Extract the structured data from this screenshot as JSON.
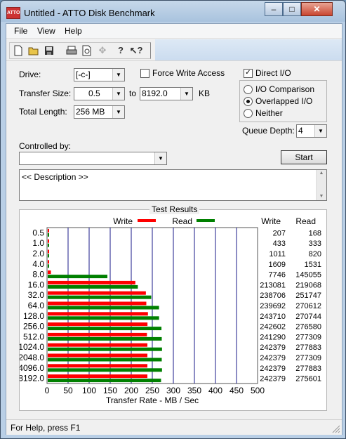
{
  "window": {
    "title": "Untitled - ATTO Disk Benchmark",
    "icon_text": "ATTO"
  },
  "caption_buttons": {
    "minimize": "–",
    "maximize": "□",
    "close": "✕"
  },
  "menu": {
    "file": "File",
    "view": "View",
    "help": "Help"
  },
  "toolbar": {
    "icons": [
      "new-icon",
      "open-icon",
      "save-icon",
      "print-icon",
      "print-preview-icon",
      "move-icon",
      "help-icon",
      "context-help-icon"
    ]
  },
  "form": {
    "drive_label": "Drive:",
    "drive_value": "[-c-]",
    "force_write_access_label": "Force Write Access",
    "force_write_access_checked": false,
    "direct_io_label": "Direct I/O",
    "direct_io_checked": true,
    "transfer_size_label": "Transfer Size:",
    "transfer_min": "0.5",
    "to_label": "to",
    "transfer_max": "8192.0",
    "transfer_unit": "KB",
    "total_length_label": "Total Length:",
    "total_length_value": "256 MB",
    "io_comparison_label": "I/O Comparison",
    "overlapped_io_label": "Overlapped I/O",
    "neither_label": "Neither",
    "selected_mode": "Overlapped I/O",
    "queue_depth_label": "Queue Depth:",
    "queue_depth_value": "4",
    "controlled_by_label": "Controlled by:",
    "controlled_by_value": "",
    "start_button": "Start",
    "description": "<< Description >>"
  },
  "results": {
    "title": "Test Results",
    "write_column": "Write",
    "read_column": "Read"
  },
  "chart_data": {
    "type": "bar",
    "xlabel": "Transfer Rate - MB / Sec",
    "xlim": [
      0,
      500
    ],
    "x_ticks": [
      "0",
      "50",
      "100",
      "150",
      "200",
      "250",
      "300",
      "350",
      "400",
      "450",
      "500"
    ],
    "grid": true,
    "legend": "top",
    "categories": [
      "0.5",
      "1.0",
      "2.0",
      "4.0",
      "8.0",
      "16.0",
      "32.0",
      "64.0",
      "128.0",
      "256.0",
      "512.0",
      "1024.0",
      "2048.0",
      "4096.0",
      "8192.0"
    ],
    "series": [
      {
        "name": "Write",
        "color": "#ff0000",
        "values": [
          0.2,
          0.42,
          0.99,
          1.57,
          7.6,
          208.1,
          233.1,
          234.1,
          238.0,
          236.9,
          235.6,
          236.7,
          236.7,
          236.7,
          236.7
        ],
        "labels": [
          "207",
          "433",
          "1011",
          "1609",
          "7746",
          "213081",
          "238706",
          "239692",
          "243710",
          "242602",
          "241290",
          "242379",
          "242379",
          "242379",
          "242379"
        ]
      },
      {
        "name": "Read",
        "color": "#008000",
        "values": [
          0.16,
          0.33,
          0.8,
          1.5,
          141.7,
          214.0,
          245.8,
          264.3,
          264.4,
          270.1,
          270.8,
          271.4,
          270.8,
          271.4,
          269.1
        ],
        "labels": [
          "168",
          "333",
          "820",
          "1531",
          "145055",
          "219068",
          "251747",
          "270612",
          "270744",
          "276580",
          "277309",
          "277883",
          "277309",
          "277883",
          "275601"
        ]
      }
    ]
  },
  "status": {
    "text": "For Help, press F1"
  }
}
